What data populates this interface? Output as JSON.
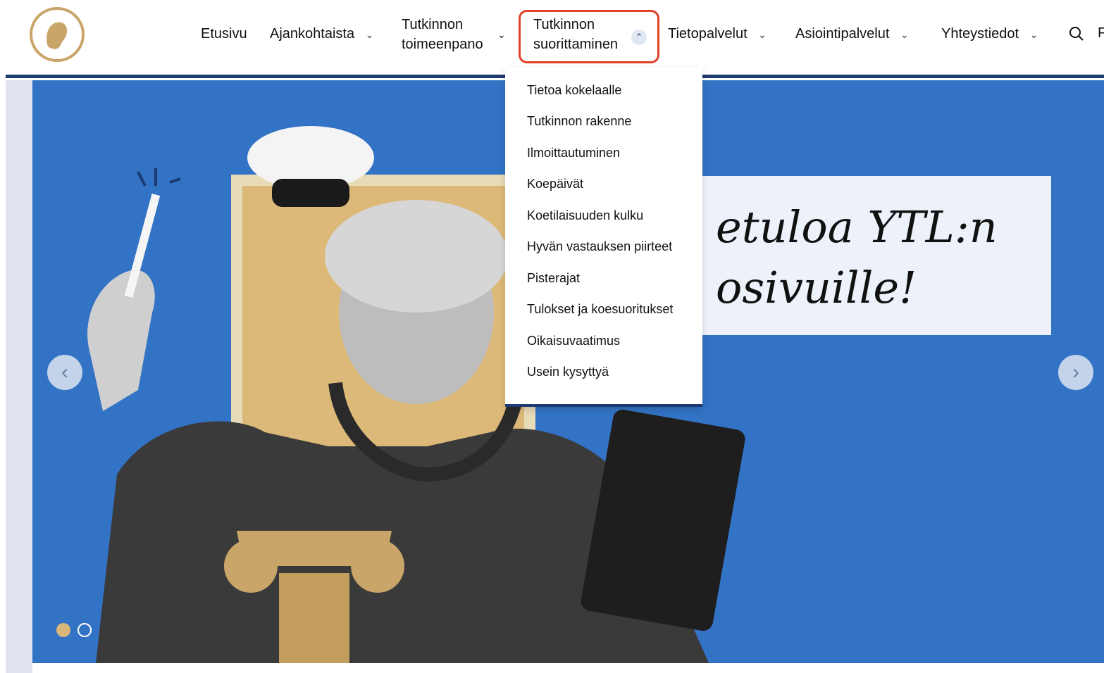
{
  "nav": {
    "items": [
      {
        "label": "Etusivu"
      },
      {
        "label": "Ajankohtaista"
      },
      {
        "line1": "Tutkinnon",
        "line2": "toimeenpano"
      },
      {
        "line1": "Tutkinnon",
        "line2": "suorittaminen"
      },
      {
        "label": "Tietopalvelut"
      },
      {
        "label": "Asiointipalvelut"
      },
      {
        "label": "Yhteystiedot"
      }
    ],
    "edge_letter": "F"
  },
  "dropdown": {
    "items": [
      "Tietoa kokelaalle",
      "Tutkinnon rakenne",
      "Ilmoittautuminen",
      "Koepäivät",
      "Koetilaisuuden kulku",
      "Hyvän vastauksen piirteet",
      "Pisterajat",
      "Tulokset ja koesuoritukset",
      "Oikaisuvaatimus",
      "Usein kysyttyä"
    ]
  },
  "hero": {
    "title_line1": "etuloa YTL:n",
    "title_line2": "osivuille!",
    "slides_total": 2,
    "slide_active": 1
  },
  "icons": {
    "search": "search-icon",
    "chevron": "chevron-down-icon",
    "chevron_up": "chevron-up-icon",
    "prev": "chevron-left-icon",
    "next": "chevron-right-icon"
  },
  "colors": {
    "accent": "#1d3a72",
    "hero_bg": "#3273c5",
    "highlight": "#e0402a",
    "gold": "#c9a569"
  }
}
